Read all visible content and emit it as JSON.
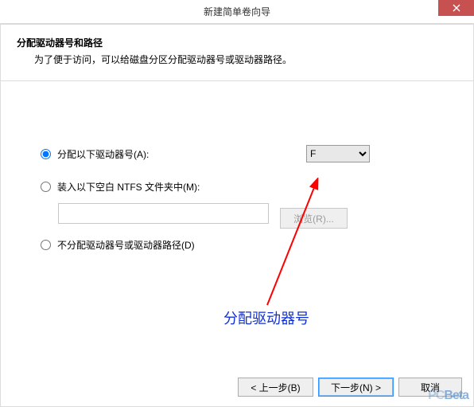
{
  "window": {
    "title": "新建简单卷向导"
  },
  "header": {
    "title": "分配驱动器号和路径",
    "subtitle": "为了便于访问，可以给磁盘分区分配驱动器号或驱动器路径。"
  },
  "options": {
    "assign_letter": {
      "label": "分配以下驱动器号(A):",
      "selected_value": "F",
      "choices": [
        "F"
      ]
    },
    "mount_folder": {
      "label": "装入以下空白 NTFS 文件夹中(M):",
      "folder_value": "",
      "browse_label": "浏览(R)..."
    },
    "no_assign": {
      "label": "不分配驱动器号或驱动器路径(D)"
    },
    "selected": "assign_letter"
  },
  "footer": {
    "back": "< 上一步(B)",
    "next": "下一步(N) >",
    "cancel": "取消"
  },
  "annotation": {
    "text": "分配驱动器号"
  },
  "watermark": "PCBeta"
}
